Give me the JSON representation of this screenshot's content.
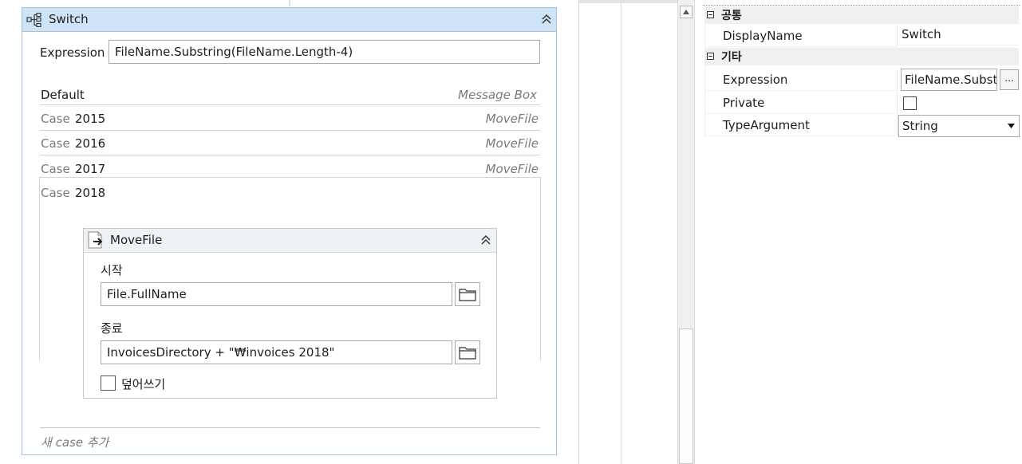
{
  "switch": {
    "title": "Switch",
    "expression_label": "Expression",
    "expression_value": "FileName.Substring(FileName.Length-4)",
    "default_label": "Default",
    "default_activity": "Message Box",
    "case_keyword": "Case",
    "cases": [
      {
        "value": "2015",
        "activity": "MoveFile"
      },
      {
        "value": "2016",
        "activity": "MoveFile"
      },
      {
        "value": "2017",
        "activity": "MoveFile"
      },
      {
        "value": "2018",
        "activity": ""
      }
    ],
    "add_case": "새 case 추가"
  },
  "movefile": {
    "title": "MoveFile",
    "from_label": "시작",
    "from_value": "File.FullName",
    "to_label": "종료",
    "to_value": "InvoicesDirectory + \"₩invoices 2018\"",
    "overwrite_label": "덮어쓰기",
    "overwrite_checked": false
  },
  "properties": {
    "cat_common": "공통",
    "cat_misc": "기타",
    "display_name_label": "DisplayName",
    "display_name_value": "Switch",
    "expression_label": "Expression",
    "expression_value": "FileName.Substr",
    "ellipsis": "...",
    "private_label": "Private",
    "private_checked": false,
    "type_argument_label": "TypeArgument",
    "type_argument_value": "String"
  },
  "icons": {
    "switch": "switch-flow-icon",
    "collapse": "double-chevron-up-icon",
    "movefile": "move-file-icon",
    "folder": "folder-icon",
    "scroll_up": "scroll-up-arrow-icon",
    "dropdown": "dropdown-arrow-icon",
    "category_toggle": "minus-box-icon"
  },
  "colors": {
    "switch_header": "#cfe3f7",
    "switch_border": "#9fc3e7",
    "category_bg": "#f0f0f0"
  }
}
